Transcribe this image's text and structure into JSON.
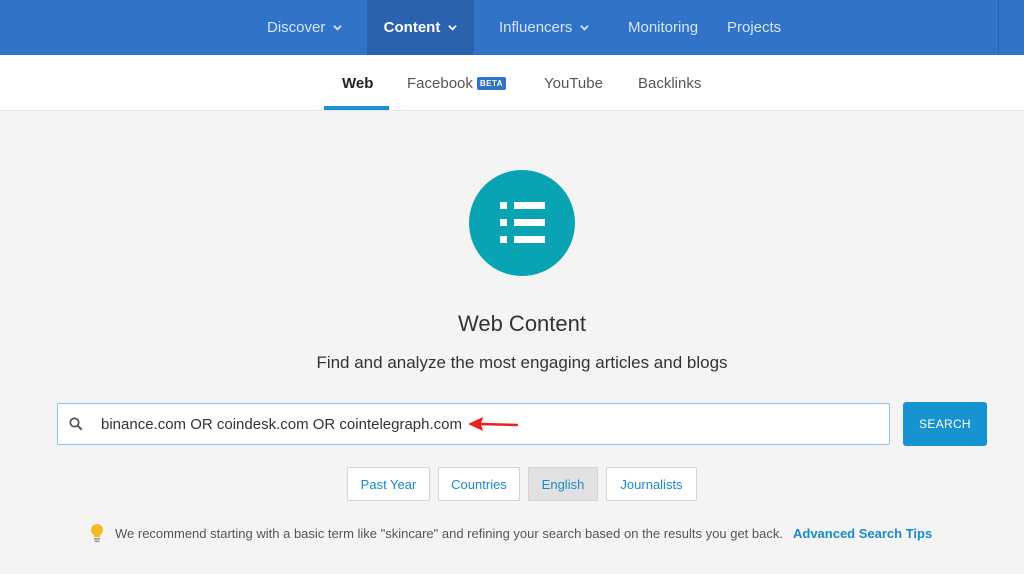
{
  "topnav": {
    "items": [
      {
        "label": "Discover",
        "dropdown": true
      },
      {
        "label": "Content",
        "dropdown": true,
        "active": true
      },
      {
        "label": "Influencers",
        "dropdown": true
      },
      {
        "label": "Monitoring"
      },
      {
        "label": "Projects"
      }
    ]
  },
  "subnav": {
    "tabs": [
      {
        "label": "Web",
        "active": true
      },
      {
        "label": "Facebook",
        "badge": "BETA"
      },
      {
        "label": "YouTube"
      },
      {
        "label": "Backlinks"
      }
    ]
  },
  "hero": {
    "icon": "list-icon",
    "title": "Web Content",
    "subtitle": "Find and analyze the most engaging articles and blogs"
  },
  "search": {
    "value": "binance.com OR coindesk.com OR cointelegraph.com",
    "button_label": "SEARCH"
  },
  "filters": [
    {
      "label": "Past Year"
    },
    {
      "label": "Countries"
    },
    {
      "label": "English",
      "selected": true
    },
    {
      "label": "Journalists"
    }
  ],
  "tip": {
    "text": "We recommend starting with a basic term like \"skincare\" and refining your search based on the results you get back.",
    "link": "Advanced Search Tips"
  },
  "colors": {
    "nav_bg": "#3173c8",
    "accent": "#1793d1",
    "hero_icon": "#0aa3b4",
    "annotation_arrow": "#e8231f"
  }
}
